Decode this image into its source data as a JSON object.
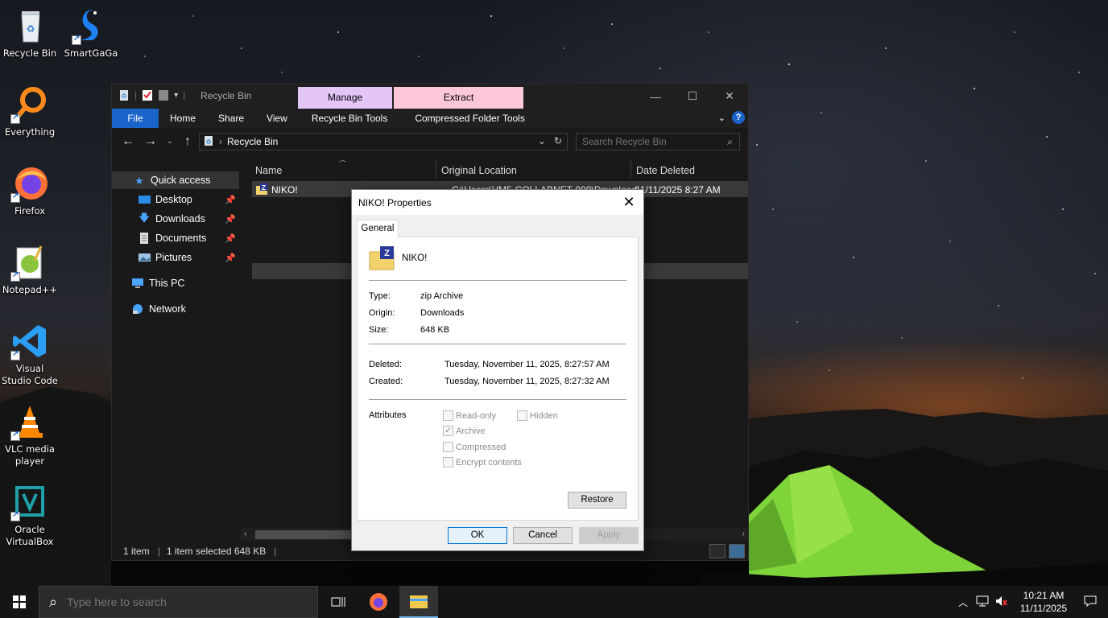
{
  "desktop": {
    "icons": [
      {
        "label": "Recycle Bin"
      },
      {
        "label": "SmartGaGa"
      },
      {
        "label": "Everything"
      },
      {
        "label": "Firefox"
      },
      {
        "label": "Notepad++"
      },
      {
        "label": "Visual Studio Code"
      },
      {
        "label": "VLC media player"
      },
      {
        "label": "Oracle VirtualBox"
      }
    ]
  },
  "explorer": {
    "title": "Recycle Bin",
    "context_tabs": {
      "manage": "Manage",
      "extract": "Extract"
    },
    "colors": {
      "manage_tab": "#e3c6f7",
      "extract_tab": "#fbc7d9",
      "file_tab": "#1a63c8"
    },
    "ribbon": {
      "file": "File",
      "home": "Home",
      "share": "Share",
      "view": "View",
      "recycle_bin_tools": "Recycle Bin Tools",
      "compressed_folder_tools": "Compressed Folder Tools"
    },
    "address": {
      "crumb": "Recycle Bin"
    },
    "search": {
      "placeholder": "Search Recycle Bin"
    },
    "nav": {
      "quick_access": "Quick access",
      "desktop": "Desktop",
      "downloads": "Downloads",
      "documents": "Documents",
      "pictures": "Pictures",
      "this_pc": "This PC",
      "network": "Network"
    },
    "columns": {
      "name": "Name",
      "original_location": "Original Location",
      "date_deleted": "Date Deleted"
    },
    "files": [
      {
        "name": "NIKO!",
        "original_location": "C:\\Users\\VM5-COLLABNET-000\\Downloads",
        "date_deleted": "11/11/2025 8:27 AM"
      }
    ],
    "status": {
      "items": "1 item",
      "selected": "1 item selected  648 KB"
    }
  },
  "dialog": {
    "title": "NIKO! Properties",
    "tab": "General",
    "file_name": "NIKO!",
    "type_label": "Type:",
    "type_value": "zip Archive",
    "origin_label": "Origin:",
    "origin_value": "Downloads",
    "size_label": "Size:",
    "size_value": "648 KB",
    "deleted_label": "Deleted:",
    "deleted_value": "Tuesday, November 11, 2025, 8:27:57 AM",
    "created_label": "Created:",
    "created_value": "Tuesday, November 11, 2025, 8:27:32 AM",
    "attributes_label": "Attributes",
    "attrs": {
      "read_only": "Read-only",
      "hidden": "Hidden",
      "archive": "Archive",
      "compressed": "Compressed",
      "encrypt": "Encrypt contents"
    },
    "archive_checked": true,
    "buttons": {
      "restore": "Restore",
      "ok": "OK",
      "cancel": "Cancel",
      "apply": "Apply"
    }
  },
  "taskbar": {
    "search_placeholder": "Type here to search",
    "time": "10:21 AM",
    "date": "11/11/2025"
  }
}
